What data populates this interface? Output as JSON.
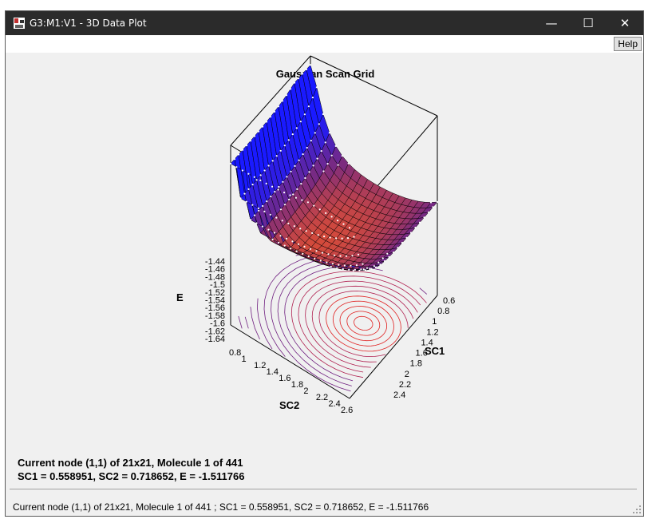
{
  "window": {
    "title": "G3:M1:V1 - 3D Data Plot",
    "minimize_glyph": "—",
    "maximize_glyph": "☐",
    "close_glyph": "✕"
  },
  "toolbar": {
    "help_label": "Help"
  },
  "plot": {
    "title": "Gaussian Scan Grid",
    "e_axis_label": "E",
    "sc1_axis_label": "SC1",
    "sc2_axis_label": "SC2",
    "e_ticks": [
      "-1.44",
      "-1.46",
      "-1.48",
      "-1.5",
      "-1.52",
      "-1.54",
      "-1.56",
      "-1.58",
      "-1.6",
      "-1.62",
      "-1.64"
    ],
    "sc1_ticks": [
      "0.6",
      "0.8",
      "1",
      "1.2",
      "1.4",
      "1.6",
      "1.8",
      "2",
      "2.2",
      "2.4"
    ],
    "sc2_ticks": [
      "0.8",
      "1",
      "1.2",
      "1.4",
      "1.6",
      "1.8",
      "2",
      "2.2",
      "2.4",
      "2.6"
    ],
    "colors": {
      "high": "#1a1aff",
      "mid": "#7a2a80",
      "low": "#ff5a1a",
      "contour_hot": "#e02020"
    }
  },
  "chart_data": {
    "type": "surface3d",
    "title": "Gaussian Scan Grid",
    "grid": "21x21",
    "x_label": "SC1",
    "y_label": "SC2",
    "z_label": "E",
    "x_ticks": [
      0.6,
      0.8,
      1,
      1.2,
      1.4,
      1.6,
      1.8,
      2,
      2.2,
      2.4
    ],
    "y_ticks": [
      0.8,
      1,
      1.2,
      1.4,
      1.6,
      1.8,
      2,
      2.2,
      2.4,
      2.6
    ],
    "z_ticks": [
      -1.44,
      -1.46,
      -1.48,
      -1.5,
      -1.52,
      -1.54,
      -1.56,
      -1.58,
      -1.6,
      -1.62,
      -1.64
    ],
    "zlim": [
      -1.64,
      -1.44
    ]
  },
  "info": {
    "line1": "Current node (1,1) of 21x21, Molecule 1 of 441",
    "line2": "SC1 = 0.558951, SC2 = 0.718652, E = -1.511766"
  },
  "status": {
    "text": "Current node (1,1) of 21x21, Molecule 1 of 441 ; SC1 = 0.558951, SC2 = 0.718652, E = -1.511766"
  }
}
